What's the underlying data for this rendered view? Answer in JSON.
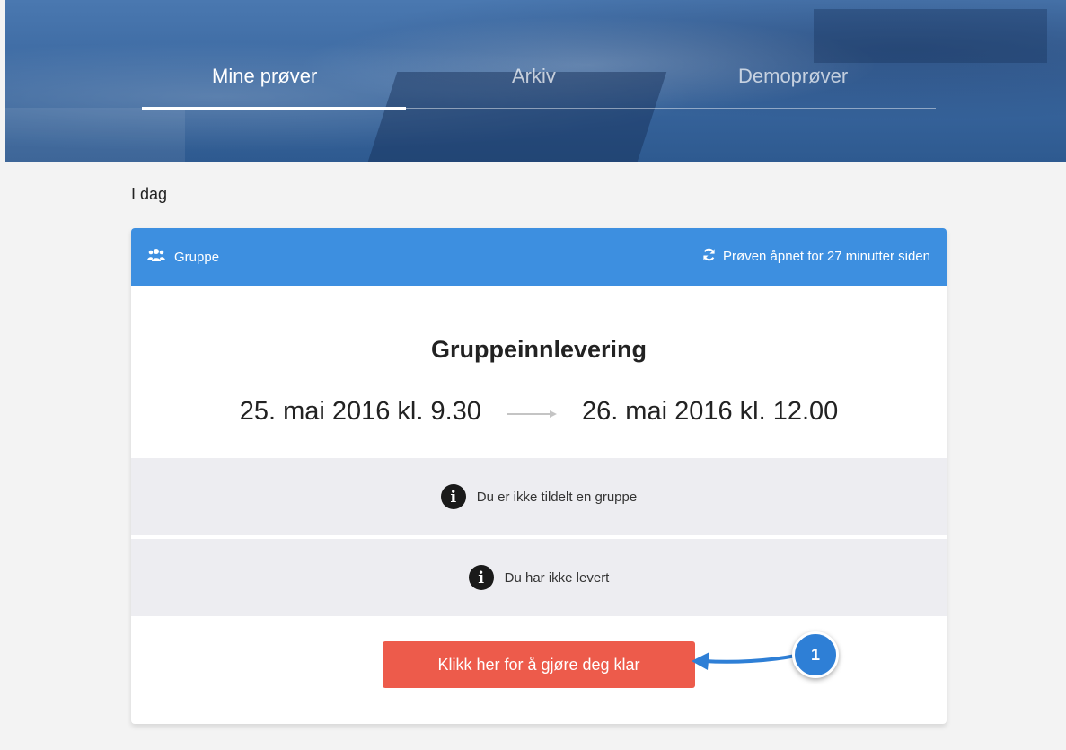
{
  "nav": {
    "tabs": [
      {
        "label": "Mine prøver",
        "active": true
      },
      {
        "label": "Arkiv",
        "active": false
      },
      {
        "label": "Demoprøver",
        "active": false
      }
    ]
  },
  "section": {
    "heading": "I dag"
  },
  "card": {
    "group_label": "Gruppe",
    "group_icon": "users-icon",
    "status_text": "Prøven åpnet for 27 minutter siden",
    "status_icon": "refresh-icon",
    "title": "Gruppeinnlevering",
    "start": "25. mai 2016 kl. 9.30",
    "end": "26. mai 2016 kl. 12.00",
    "info": [
      {
        "text": "Du er ikke tildelt en gruppe",
        "icon": "info-icon"
      },
      {
        "text": "Du har ikke levert",
        "icon": "info-icon"
      }
    ],
    "button_label": "Klikk her for å gjøre deg klar"
  },
  "annotation": {
    "number": "1"
  },
  "colors": {
    "card_header": "#3d8fe0",
    "button": "#ed5b4b",
    "info_row": "#ededf1",
    "annotation": "#2e7fd6"
  }
}
